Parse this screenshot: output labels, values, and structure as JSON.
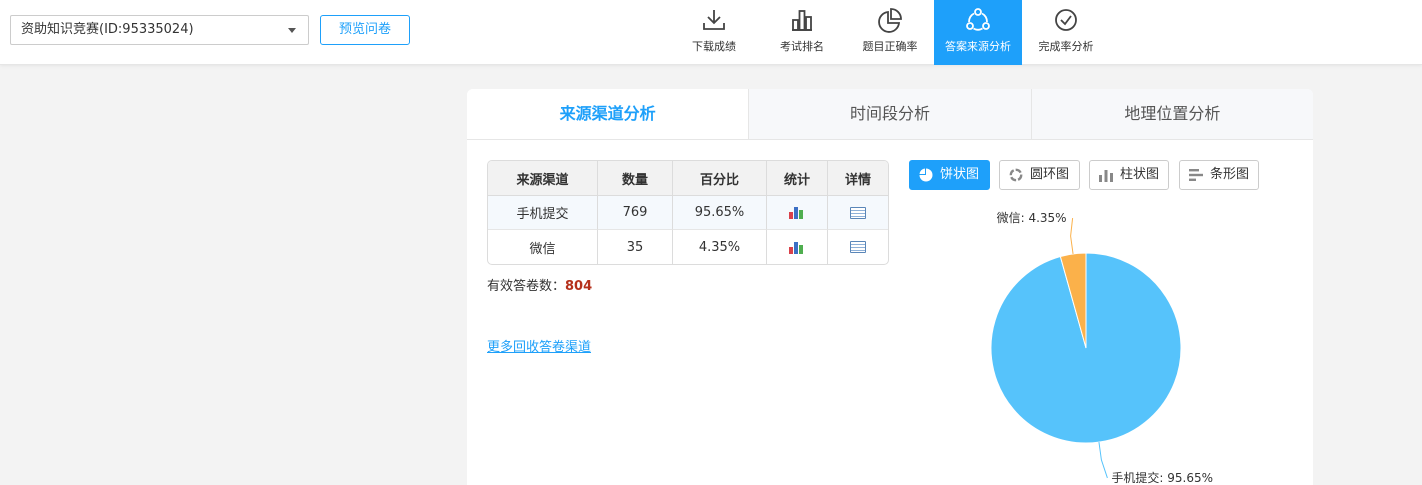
{
  "header": {
    "survey_select": "资助知识竞赛(ID:95335024)",
    "preview_button": "预览问卷",
    "tools": [
      {
        "label": "下载成绩",
        "icon": "download-icon",
        "active": false
      },
      {
        "label": "考试排名",
        "icon": "ranking-icon",
        "active": false
      },
      {
        "label": "题目正确率",
        "icon": "pie-chart-icon",
        "active": false
      },
      {
        "label": "答案来源分析",
        "icon": "share-nodes-icon",
        "active": true
      },
      {
        "label": "完成率分析",
        "icon": "check-circle-icon",
        "active": false
      }
    ],
    "active_color": "#1ea0fa"
  },
  "tabs": [
    {
      "label": "来源渠道分析",
      "active": true
    },
    {
      "label": "时间段分析",
      "active": false
    },
    {
      "label": "地理位置分析",
      "active": false
    }
  ],
  "table": {
    "headers": [
      "来源渠道",
      "数量",
      "百分比",
      "统计",
      "详情"
    ],
    "rows": [
      {
        "channel": "手机提交",
        "count": "769",
        "percent": "95.65%"
      },
      {
        "channel": "微信",
        "count": "35",
        "percent": "4.35%"
      }
    ]
  },
  "summary": {
    "label": "有效答卷数：",
    "value": "804"
  },
  "more_link": "更多回收答卷渠道",
  "chart_types": [
    {
      "label": "饼状图",
      "icon": "pie-icon",
      "active": true
    },
    {
      "label": "圆环图",
      "icon": "donut-icon",
      "active": false
    },
    {
      "label": "柱状图",
      "icon": "column-chart-icon",
      "active": false
    },
    {
      "label": "条形图",
      "icon": "bar-chart-icon",
      "active": false
    }
  ],
  "chart_data": {
    "type": "pie",
    "slices": [
      {
        "name": "手机提交",
        "value": 95.65,
        "label": "手机提交: 95.65%",
        "color": "#56c3fb"
      },
      {
        "name": "微信",
        "value": 4.35,
        "label": "微信: 4.35%",
        "color": "#fbb14a"
      }
    ]
  }
}
